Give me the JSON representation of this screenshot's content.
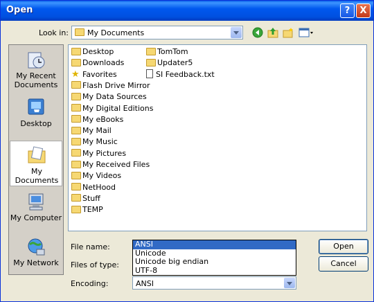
{
  "window": {
    "title": "Open"
  },
  "controls": {
    "help": "?",
    "close": "X"
  },
  "lookin": {
    "label": "Look in:",
    "value": "My Documents"
  },
  "places": [
    {
      "label": "My Recent Documents",
      "icon": "recent-documents-icon"
    },
    {
      "label": "Desktop",
      "icon": "desktop-icon"
    },
    {
      "label": "My Documents",
      "icon": "my-documents-icon"
    },
    {
      "label": "My Computer",
      "icon": "my-computer-icon"
    },
    {
      "label": "My Network",
      "icon": "my-network-icon"
    }
  ],
  "files": [
    {
      "name": "Desktop",
      "icon": "folder-icon"
    },
    {
      "name": "Downloads",
      "icon": "folder-icon"
    },
    {
      "name": "Favorites",
      "icon": "star-icon"
    },
    {
      "name": "Flash Drive Mirror",
      "icon": "folder-icon"
    },
    {
      "name": "My Data Sources",
      "icon": "folder-icon"
    },
    {
      "name": "My Digital Editions",
      "icon": "folder-icon"
    },
    {
      "name": "My eBooks",
      "icon": "folder-icon"
    },
    {
      "name": "My Mail",
      "icon": "folder-icon"
    },
    {
      "name": "My Music",
      "icon": "folder-icon"
    },
    {
      "name": "My Pictures",
      "icon": "folder-icon"
    },
    {
      "name": "My Received Files",
      "icon": "folder-icon"
    },
    {
      "name": "My Videos",
      "icon": "folder-icon"
    },
    {
      "name": "NetHood",
      "icon": "folder-icon"
    },
    {
      "name": "Stuff",
      "icon": "folder-icon"
    },
    {
      "name": "TEMP",
      "icon": "folder-icon"
    },
    {
      "name": "TomTom",
      "icon": "folder-icon"
    },
    {
      "name": "Updater5",
      "icon": "folder-icon"
    },
    {
      "name": "SI Feedback.txt",
      "icon": "text-file-icon"
    }
  ],
  "form": {
    "filename_label": "File name:",
    "filetype_label": "Files of type:",
    "encoding_label": "Encoding:",
    "encoding_value": "ANSI",
    "encoding_options": [
      "ANSI",
      "Unicode",
      "Unicode big endian",
      "UTF-8"
    ],
    "selected_option": "ANSI"
  },
  "buttons": {
    "open": "Open",
    "cancel": "Cancel"
  },
  "colors": {
    "titlebar": "#0058ee",
    "selection": "#316ac5",
    "dialog_bg": "#ece9d8"
  }
}
